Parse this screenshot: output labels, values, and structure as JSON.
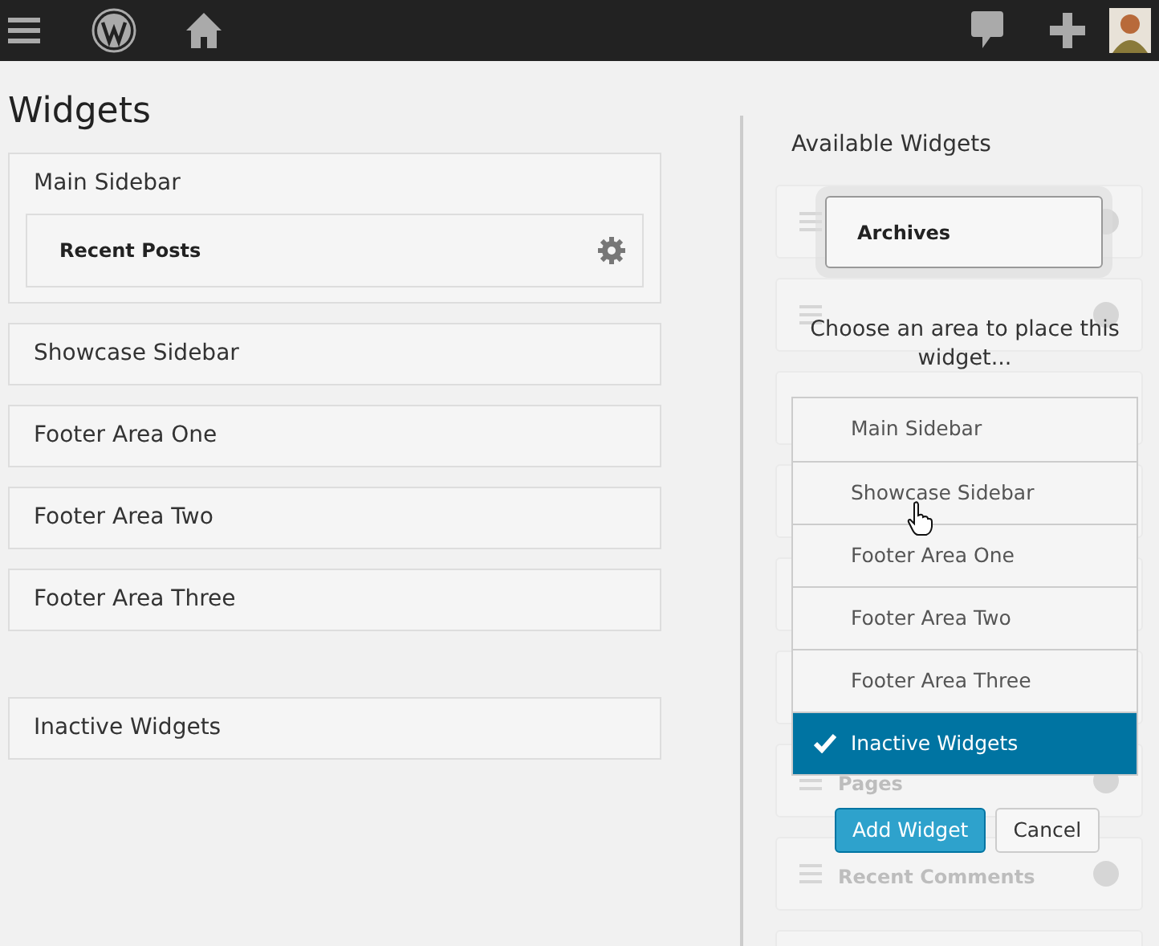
{
  "page": {
    "title": "Widgets"
  },
  "sidebars": [
    {
      "title": "Main Sidebar",
      "widgets": [
        {
          "label": "Recent Posts"
        }
      ]
    },
    {
      "title": "Showcase Sidebar"
    },
    {
      "title": "Footer Area One"
    },
    {
      "title": "Footer Area Two"
    },
    {
      "title": "Footer Area Three"
    },
    {
      "title": "Inactive Widgets",
      "kind": "inactive"
    }
  ],
  "available": {
    "title": "Available Widgets",
    "cards": [
      {
        "kind": "blank"
      },
      {
        "kind": "blank"
      },
      {
        "kind": "plain"
      },
      {
        "kind": "plain"
      },
      {
        "kind": "plain"
      },
      {
        "kind": "plain"
      },
      {
        "kind": "widget",
        "label": "Pages"
      },
      {
        "kind": "widget",
        "label": "Recent Comments"
      },
      {
        "kind": "plain"
      }
    ]
  },
  "chooser": {
    "widget": "Archives",
    "prompt": "Choose an area to place this widget...",
    "areas": [
      {
        "label": "Main Sidebar",
        "selected": false
      },
      {
        "label": "Showcase Sidebar",
        "selected": false
      },
      {
        "label": "Footer Area One",
        "selected": false
      },
      {
        "label": "Footer Area Two",
        "selected": false
      },
      {
        "label": "Footer Area Three",
        "selected": false
      },
      {
        "label": "Inactive Widgets",
        "selected": true
      }
    ],
    "buttons": [
      {
        "label": "Add Widget",
        "kind": "primary"
      },
      {
        "label": "Cancel",
        "kind": "secondary"
      }
    ]
  }
}
